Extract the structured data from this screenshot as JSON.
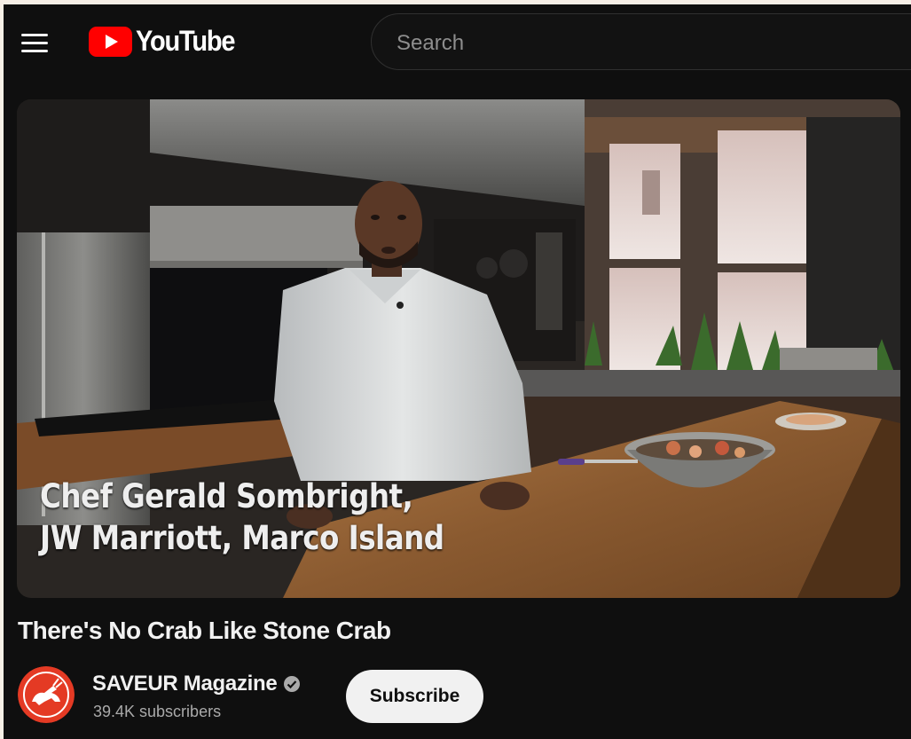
{
  "header": {
    "menu_icon": "hamburger-menu-icon",
    "logo_text": "YouTube",
    "search_placeholder": "Search"
  },
  "video": {
    "caption_line1": "Chef Gerald Sombright,",
    "caption_line2": "JW Marriott, Marco Island",
    "title": "There's No Crab Like Stone Crab"
  },
  "channel": {
    "name": "SAVEUR Magazine",
    "verified_icon": "verified-check-icon",
    "subscribers": "39.4K subscribers",
    "subscribe_label": "Subscribe"
  },
  "colors": {
    "background": "#0f0f0f",
    "brand_red": "#ff0000",
    "text_primary": "#f1f1f1",
    "text_secondary": "#aaaaaa"
  }
}
